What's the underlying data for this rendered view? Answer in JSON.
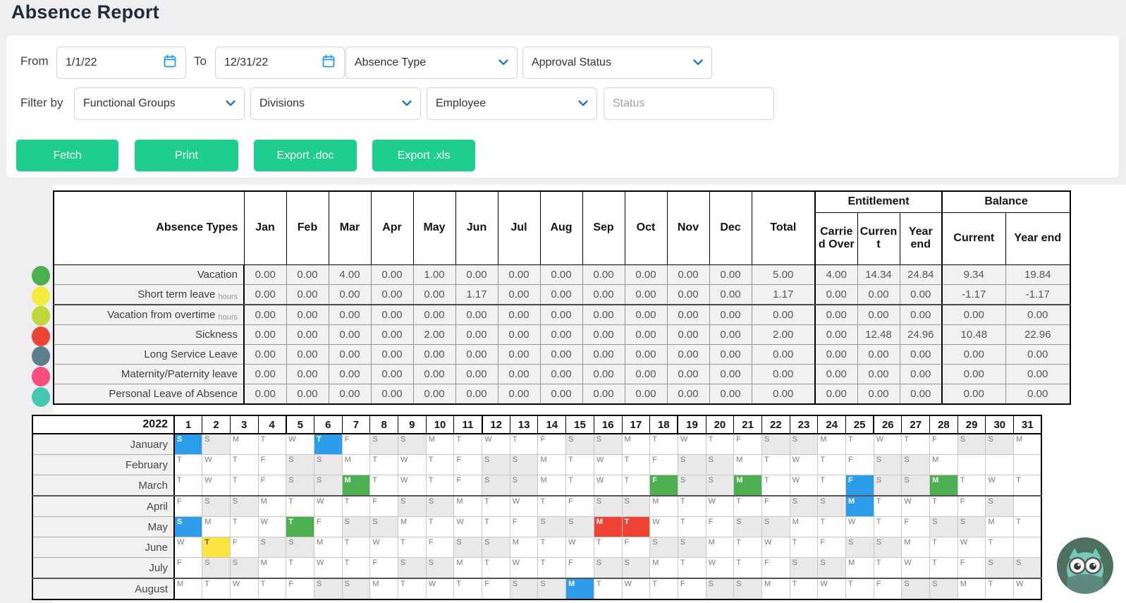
{
  "page": {
    "title": "Absence Report"
  },
  "filters": {
    "from_label": "From",
    "from_value": "1/1/22",
    "to_label": "To",
    "to_value": "12/31/22",
    "absence_type": "Absence Type",
    "approval_status": "Approval Status",
    "filter_by_label": "Filter by",
    "functional_groups": "Functional Groups",
    "divisions": "Divisions",
    "employee": "Employee",
    "status_placeholder": "Status"
  },
  "buttons": {
    "fetch": "Fetch",
    "print": "Print",
    "export_doc": "Export .doc",
    "export_xls": "Export .xls"
  },
  "colors": {
    "button_green": "#1fce8f",
    "accent_blue": "#2176d2",
    "highlights": {
      "blue": "#2d9ceb",
      "green": "#4caf50",
      "red": "#ef4334",
      "yellow": "#ffe341"
    }
  },
  "summary_table": {
    "header": {
      "label": "Absence Types",
      "months": [
        "Jan",
        "Feb",
        "Mar",
        "Apr",
        "May",
        "Jun",
        "Jul",
        "Aug",
        "Sep",
        "Oct",
        "Nov",
        "Dec"
      ],
      "total": "Total",
      "entitlement": "Entitlement",
      "balance": "Balance",
      "carried_over": "Carried Over",
      "ent_current": "Current",
      "ent_year_end": "Year end",
      "bal_current": "Current",
      "bal_year_end": "Year end"
    },
    "rows": [
      {
        "dot_color": "#4caf50",
        "label": "Vacation",
        "unit": "",
        "months": [
          "0.00",
          "0.00",
          "4.00",
          "0.00",
          "1.00",
          "0.00",
          "0.00",
          "0.00",
          "0.00",
          "0.00",
          "0.00",
          "0.00"
        ],
        "total": "5.00",
        "carried_over": "4.00",
        "ent_current": "14.34",
        "ent_year_end": "24.84",
        "bal_current": "9.34",
        "bal_year_end": "19.84"
      },
      {
        "dot_color": "#f6e93f",
        "label": "Short term leave",
        "unit": "hours",
        "months": [
          "0.00",
          "0.00",
          "0.00",
          "0.00",
          "0.00",
          "1.17",
          "0.00",
          "0.00",
          "0.00",
          "0.00",
          "0.00",
          "0.00"
        ],
        "total": "1.17",
        "carried_over": "0.00",
        "ent_current": "0.00",
        "ent_year_end": "0.00",
        "bal_current": "-1.17",
        "bal_year_end": "-1.17"
      },
      {
        "dot_color": "#c1d639",
        "label": "Vacation from overtime",
        "unit": "hours",
        "months": [
          "0.00",
          "0.00",
          "0.00",
          "0.00",
          "0.00",
          "0.00",
          "0.00",
          "0.00",
          "0.00",
          "0.00",
          "0.00",
          "0.00"
        ],
        "total": "0.00",
        "carried_over": "0.00",
        "ent_current": "0.00",
        "ent_year_end": "0.00",
        "bal_current": "0.00",
        "bal_year_end": "0.00"
      },
      {
        "dot_color": "#ef4334",
        "label": "Sickness",
        "unit": "",
        "months": [
          "0.00",
          "0.00",
          "0.00",
          "0.00",
          "2.00",
          "0.00",
          "0.00",
          "0.00",
          "0.00",
          "0.00",
          "0.00",
          "0.00"
        ],
        "total": "2.00",
        "carried_over": "0.00",
        "ent_current": "12.48",
        "ent_year_end": "24.96",
        "bal_current": "10.48",
        "bal_year_end": "22.96"
      },
      {
        "dot_color": "#5f7d8c",
        "label": "Long Service Leave",
        "unit": "",
        "months": [
          "0.00",
          "0.00",
          "0.00",
          "0.00",
          "0.00",
          "0.00",
          "0.00",
          "0.00",
          "0.00",
          "0.00",
          "0.00",
          "0.00"
        ],
        "total": "0.00",
        "carried_over": "0.00",
        "ent_current": "0.00",
        "ent_year_end": "0.00",
        "bal_current": "0.00",
        "bal_year_end": "0.00"
      },
      {
        "dot_color": "#f94d7e",
        "label": "Maternity/Paternity leave",
        "unit": "",
        "months": [
          "0.00",
          "0.00",
          "0.00",
          "0.00",
          "0.00",
          "0.00",
          "0.00",
          "0.00",
          "0.00",
          "0.00",
          "0.00",
          "0.00"
        ],
        "total": "0.00",
        "carried_over": "0.00",
        "ent_current": "0.00",
        "ent_year_end": "0.00",
        "bal_current": "0.00",
        "bal_year_end": "0.00"
      },
      {
        "dot_color": "#41c9b4",
        "label": "Personal Leave of Absence",
        "unit": "",
        "months": [
          "0.00",
          "0.00",
          "0.00",
          "0.00",
          "0.00",
          "0.00",
          "0.00",
          "0.00",
          "0.00",
          "0.00",
          "0.00",
          "0.00"
        ],
        "total": "0.00",
        "carried_over": "0.00",
        "ent_current": "0.00",
        "ent_year_end": "0.00",
        "bal_current": "0.00",
        "bal_year_end": "0.00"
      }
    ]
  },
  "calendar": {
    "year": "2022",
    "day_numbers": [
      "1",
      "2",
      "3",
      "4",
      "5",
      "6",
      "7",
      "8",
      "9",
      "10",
      "11",
      "12",
      "13",
      "14",
      "15",
      "16",
      "17",
      "18",
      "19",
      "20",
      "21",
      "22",
      "23",
      "24",
      "25",
      "26",
      "27",
      "28",
      "29",
      "30",
      "31"
    ],
    "week_marker_days": [
      5,
      12,
      19,
      26
    ],
    "months": [
      {
        "name": "January",
        "letters": [
          "S",
          "S",
          "M",
          "T",
          "W",
          "T",
          "F",
          "S",
          "S",
          "M",
          "T",
          "W",
          "T",
          "F",
          "S",
          "S",
          "M",
          "T",
          "W",
          "T",
          "F",
          "S",
          "S",
          "M",
          "T",
          "W",
          "T",
          "F",
          "S",
          "S",
          "M"
        ],
        "highlights": {
          "1": "blue",
          "6": "blue"
        }
      },
      {
        "name": "February",
        "letters": [
          "T",
          "W",
          "T",
          "F",
          "S",
          "S",
          "M",
          "T",
          "W",
          "T",
          "F",
          "S",
          "S",
          "M",
          "T",
          "W",
          "T",
          "F",
          "S",
          "S",
          "M",
          "T",
          "W",
          "T",
          "F",
          "S",
          "S",
          "M",
          "",
          "",
          ""
        ],
        "highlights": {}
      },
      {
        "name": "March",
        "letters": [
          "T",
          "W",
          "T",
          "F",
          "S",
          "S",
          "M",
          "T",
          "W",
          "T",
          "F",
          "S",
          "S",
          "M",
          "T",
          "W",
          "T",
          "F",
          "S",
          "S",
          "M",
          "T",
          "W",
          "T",
          "F",
          "S",
          "S",
          "M",
          "T",
          "W",
          "T"
        ],
        "highlights": {
          "7": "green",
          "18": "green",
          "21": "green",
          "25": "blue",
          "28": "green"
        }
      },
      {
        "name": "April",
        "letters": [
          "F",
          "S",
          "S",
          "M",
          "T",
          "W",
          "T",
          "F",
          "S",
          "S",
          "M",
          "T",
          "W",
          "T",
          "F",
          "S",
          "S",
          "M",
          "T",
          "W",
          "T",
          "F",
          "S",
          "S",
          "M",
          "T",
          "W",
          "T",
          "F",
          "S",
          ""
        ],
        "highlights": {
          "25": "blue"
        }
      },
      {
        "name": "May",
        "letters": [
          "S",
          "M",
          "T",
          "W",
          "T",
          "F",
          "S",
          "S",
          "M",
          "T",
          "W",
          "T",
          "F",
          "S",
          "S",
          "M",
          "T",
          "W",
          "T",
          "F",
          "S",
          "S",
          "M",
          "T",
          "W",
          "T",
          "F",
          "S",
          "S",
          "M",
          "T"
        ],
        "highlights": {
          "1": "blue",
          "5": "green",
          "16": "red",
          "17": "red"
        }
      },
      {
        "name": "June",
        "letters": [
          "W",
          "T",
          "F",
          "S",
          "S",
          "M",
          "T",
          "W",
          "T",
          "F",
          "S",
          "S",
          "M",
          "T",
          "W",
          "T",
          "F",
          "S",
          "S",
          "M",
          "T",
          "W",
          "T",
          "F",
          "S",
          "S",
          "M",
          "T",
          "W",
          "T",
          ""
        ],
        "highlights": {
          "2": "yellow"
        }
      },
      {
        "name": "July",
        "letters": [
          "F",
          "S",
          "S",
          "M",
          "T",
          "W",
          "T",
          "F",
          "S",
          "S",
          "M",
          "T",
          "W",
          "T",
          "F",
          "S",
          "S",
          "M",
          "T",
          "W",
          "T",
          "F",
          "S",
          "S",
          "M",
          "T",
          "W",
          "T",
          "F",
          "S",
          "S"
        ],
        "highlights": {}
      },
      {
        "name": "August",
        "letters": [
          "M",
          "T",
          "W",
          "T",
          "F",
          "S",
          "S",
          "M",
          "T",
          "W",
          "T",
          "F",
          "S",
          "S",
          "M",
          "T",
          "W",
          "T",
          "F",
          "S",
          "S",
          "M",
          "T",
          "W",
          "T",
          "F",
          "S",
          "S",
          "M",
          "T",
          "W"
        ],
        "highlights": {
          "15": "blue"
        }
      }
    ]
  },
  "widgets": {
    "chat_owl": "owl-chat-widget"
  }
}
